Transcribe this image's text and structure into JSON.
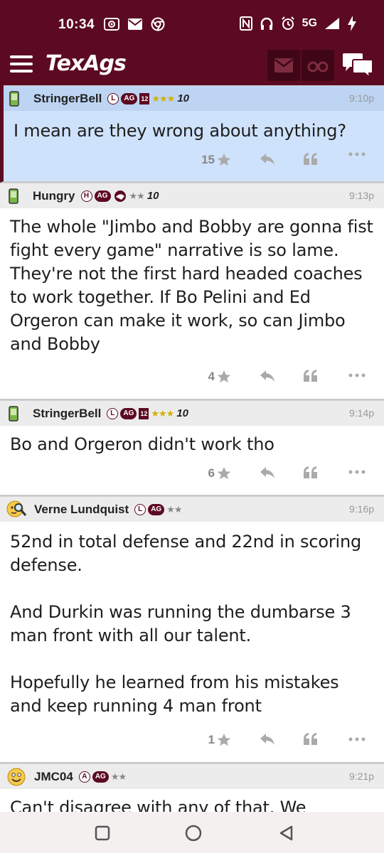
{
  "status": {
    "time": "10:34",
    "network": "5G"
  },
  "header": {
    "logo": "TexAgs"
  },
  "posts": [
    {
      "username": "StringerBell",
      "badges": [
        "L",
        "AG",
        "12",
        "★★★",
        "10"
      ],
      "time": "9:10p",
      "body": "I mean are they wrong about anything?",
      "stars": "15"
    },
    {
      "username": "Hungry",
      "badges": [
        "H",
        "AG",
        "★★",
        "10"
      ],
      "time": "9:13p",
      "body": "The whole \"Jimbo and Bobby are gonna fist fight every game\" narrative is so lame. They're not the first hard headed coaches to work together. If Bo Pelini and Ed Orgeron can make it work, so can Jimbo and Bobby",
      "stars": "4"
    },
    {
      "username": "StringerBell",
      "badges": [
        "L",
        "AG",
        "12",
        "★★★",
        "10"
      ],
      "time": "9:14p",
      "body": "Bo and Orgeron didn't work tho",
      "stars": "6"
    },
    {
      "username": "Verne Lundquist",
      "badges": [
        "L",
        "AG",
        "★★"
      ],
      "time": "9:16p",
      "body": "52nd in total defense and 22nd in scoring defense.\n\nAnd Durkin was running the dumbarse 3 man front with all our talent.\n\nHopefully he learned from his mistakes and keep running 4 man front",
      "stars": "1"
    },
    {
      "username": "JMC04",
      "badges": [
        "A",
        "AG",
        "★★"
      ],
      "time": "9:21p",
      "body": "Can't disagree with any of that. We",
      "stars": ""
    }
  ],
  "colors": {
    "maroon": "#5c0a22",
    "highlight": "#cfe2fb"
  }
}
